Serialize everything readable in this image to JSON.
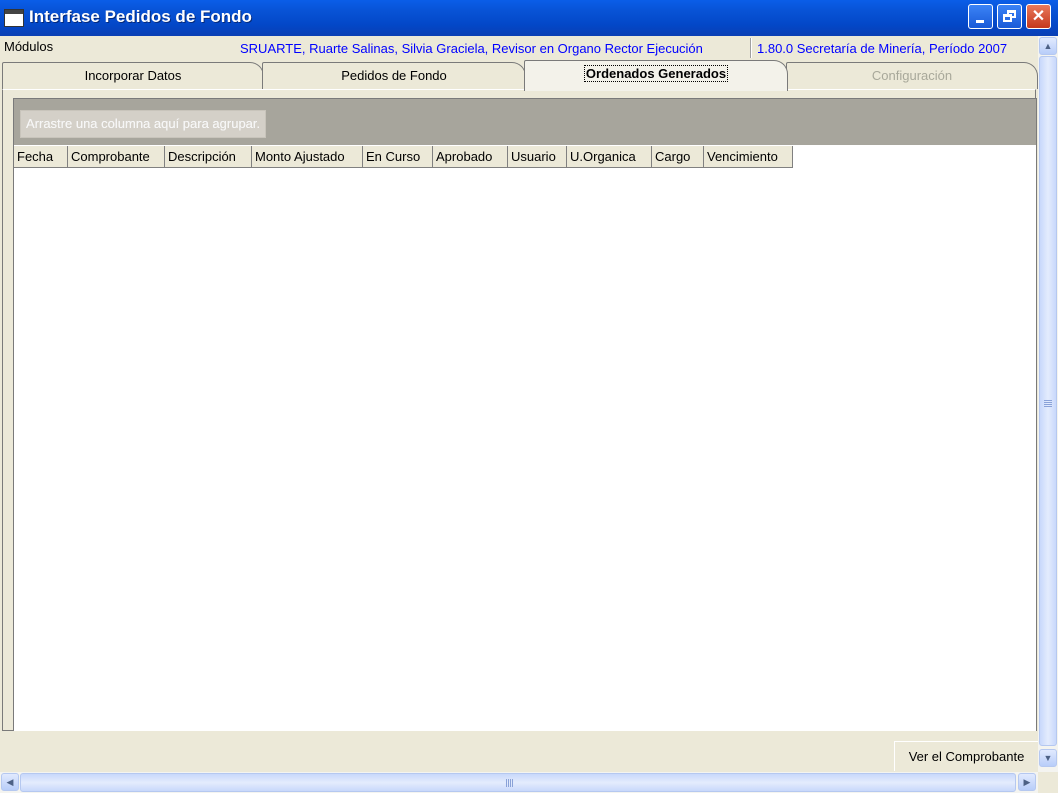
{
  "window": {
    "title": "Interfase Pedidos de Fondo",
    "icon": "app-icon"
  },
  "inforow": {
    "modulos_label": "Módulos",
    "user": "SRUARTE, Ruarte Salinas, Silvia Graciela, Revisor en Organo Rector Ejecución",
    "version": "1.80.0 Secretaría de Minería, Período 2007"
  },
  "tabs": [
    {
      "label": "Incorporar Datos",
      "state": "normal"
    },
    {
      "label": "Pedidos de Fondo",
      "state": "normal"
    },
    {
      "label": "Ordenados Generados",
      "state": "active"
    },
    {
      "label": "Configuración",
      "state": "disabled"
    }
  ],
  "grid": {
    "group_hint": "Arrastre una columna aquí para agrupar.",
    "columns": [
      "Fecha",
      "Comprobante",
      "Descripción",
      "Monto Ajustado",
      "En Curso",
      "Aprobado",
      "Usuario",
      "U.Organica",
      "Cargo",
      "Vencimiento"
    ],
    "rows": []
  },
  "buttons": {
    "ver_comprobante": "Ver el Comprobante"
  },
  "colors": {
    "titlebar": "#0853d6",
    "info_text": "#0000ff",
    "window_bg": "#ece9d8",
    "group_bar": "#a7a59c"
  }
}
